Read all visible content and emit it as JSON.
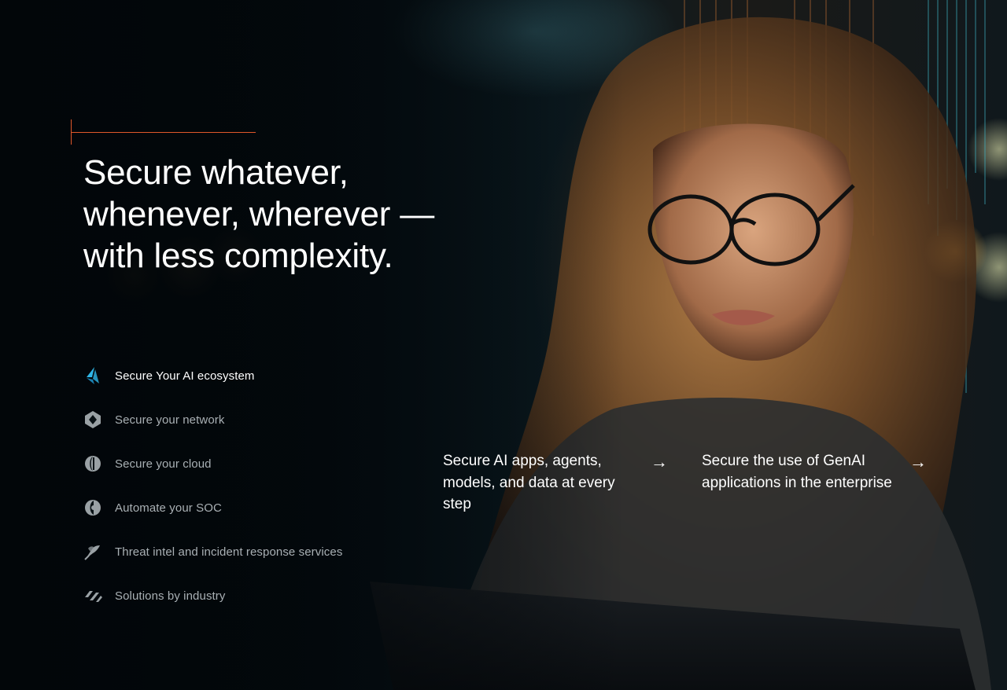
{
  "hero": {
    "headline": "Secure whatever, whenever, wherever — with less complexity.",
    "accent_color": "#e0582a",
    "background_image": "woman-with-glasses-looking-at-laptop"
  },
  "solutions": {
    "items": [
      {
        "label": "Secure Your AI ecosystem",
        "icon": "ai-ecosystem-icon",
        "active": true
      },
      {
        "label": "Secure your network",
        "icon": "network-icon",
        "active": false
      },
      {
        "label": "Secure your cloud",
        "icon": "cloud-icon",
        "active": false
      },
      {
        "label": "Automate your SOC",
        "icon": "soc-icon",
        "active": false
      },
      {
        "label": "Threat intel and incident response services",
        "icon": "threat-intel-icon",
        "active": false
      },
      {
        "label": "Solutions by industry",
        "icon": "industry-icon",
        "active": false
      }
    ],
    "active_icon_color": "#2fb6e8"
  },
  "cards": [
    {
      "text": "Secure AI apps, agents, models, and data at every step",
      "icon": "arrow-right-icon",
      "arrow": "→"
    },
    {
      "text": "Secure the use of GenAI applications in the enterprise",
      "icon": "arrow-right-icon",
      "arrow": "→"
    }
  ]
}
